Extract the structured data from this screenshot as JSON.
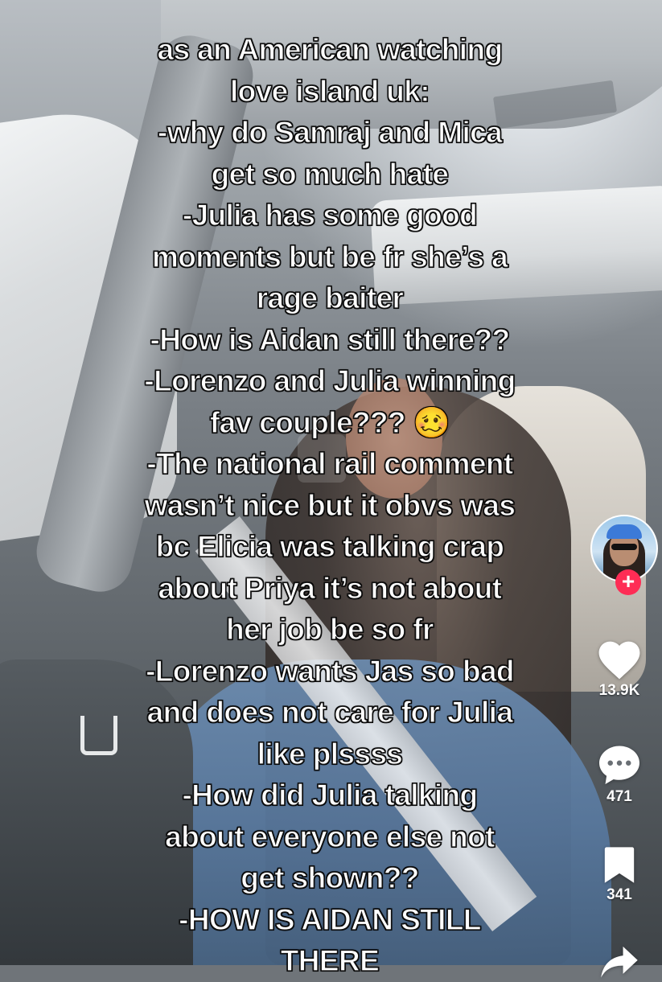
{
  "caption": {
    "lines": [
      "as an American watching",
      "love island uk:",
      "-why do Samraj and Mica",
      "get so much hate",
      "-Julia has some good",
      "moments but be fr she’s a",
      "rage baiter",
      "-How is Aidan still there??",
      "-Lorenzo and Julia winning",
      "fav couple??? 🥴",
      "-The national rail comment",
      "wasn’t nice but it obvs was",
      "bc Elicia was talking crap",
      "about Priya it’s not about",
      "her job be so fr",
      "-Lorenzo wants Jas so bad",
      "and does not care for Julia",
      "like plssss",
      "-How did Julia talking",
      "about everyone else not",
      "get shown??",
      "-HOW IS AIDAN STILL",
      "THERE"
    ]
  },
  "sidebar": {
    "follow_symbol": "+",
    "likes": "13.9K",
    "comments": "471",
    "bookmarks": "341"
  },
  "icons": {
    "like": "heart-icon",
    "comment": "comment-bubble-icon",
    "bookmark": "bookmark-icon",
    "share": "share-arrow-icon",
    "follow": "plus-icon"
  },
  "colors": {
    "follow_accent": "#fe2c55",
    "text": "#ffffff"
  }
}
